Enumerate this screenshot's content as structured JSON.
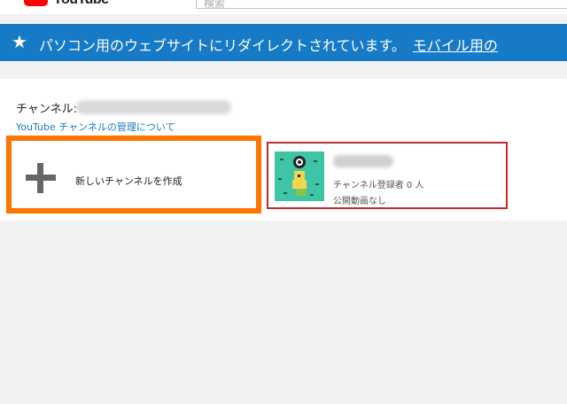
{
  "masthead": {
    "logo_text": "YouTube",
    "search_placeholder": "検索"
  },
  "banner": {
    "star": "★",
    "message": "パソコン用のウェブサイトにリダイレクトされています。",
    "link": "モバイル用の"
  },
  "channel_section": {
    "label": "チャンネル:",
    "manage_link": "YouTube チャンネルの管理について",
    "create_button": "新しいチャンネルを作成",
    "existing_channel": {
      "subscribers": "チャンネル登録者 0 人",
      "videos": "公開動画なし"
    }
  },
  "colors": {
    "banner": "#167ac6",
    "highlight_orange": "#ff7500",
    "highlight_red": "#c0282d",
    "thumb": "#3fc4a5"
  }
}
